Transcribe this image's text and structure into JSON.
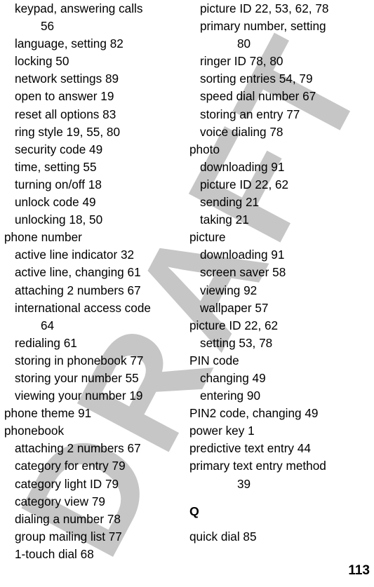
{
  "page": {
    "folio": "113",
    "watermark": "DRAFT",
    "watermark_color": "#c3c3c3",
    "text_color": "#000000",
    "background_color": "#ffffff"
  },
  "columns": [
    {
      "name": "left-column",
      "entries": [
        {
          "level": 1,
          "text": "keypad, answering calls"
        },
        {
          "level": "cont",
          "text": "56"
        },
        {
          "level": 1,
          "text": "language, setting  82"
        },
        {
          "level": 1,
          "text": "locking  50"
        },
        {
          "level": 1,
          "text": "network settings  89"
        },
        {
          "level": 1,
          "text": "open to answer  19"
        },
        {
          "level": 1,
          "text": "reset all options  83"
        },
        {
          "level": 1,
          "text": "ring style  19, 55, 80"
        },
        {
          "level": 1,
          "text": "security code  49"
        },
        {
          "level": 1,
          "text": "time, setting  55"
        },
        {
          "level": 1,
          "text": "turning on/off  18"
        },
        {
          "level": 1,
          "text": "unlock code  49"
        },
        {
          "level": 1,
          "text": "unlocking  18, 50"
        },
        {
          "level": 0,
          "text": "phone number"
        },
        {
          "level": 1,
          "text": "active line indicator  32"
        },
        {
          "level": 1,
          "text": "active line, changing  61"
        },
        {
          "level": 1,
          "text": "attaching 2 numbers  67"
        },
        {
          "level": 1,
          "text": "international access code"
        },
        {
          "level": "cont",
          "text": "64"
        },
        {
          "level": 1,
          "text": "redialing  61"
        },
        {
          "level": 1,
          "text": "storing in phonebook  77"
        },
        {
          "level": 1,
          "text": "storing your number  55"
        },
        {
          "level": 1,
          "text": "viewing your number  19"
        },
        {
          "level": 0,
          "text": "phone theme  91"
        },
        {
          "level": 0,
          "text": "phonebook"
        },
        {
          "level": 1,
          "text": "attaching 2 numbers  67"
        },
        {
          "level": 1,
          "text": "category for entry  79"
        },
        {
          "level": 1,
          "text": "category light ID  79"
        },
        {
          "level": 1,
          "text": "category view  79"
        },
        {
          "level": 1,
          "text": "dialing a number  78"
        },
        {
          "level": 1,
          "text": "group mailing list  77"
        },
        {
          "level": 1,
          "text": "1-touch dial  68"
        }
      ]
    },
    {
      "name": "right-column",
      "entries": [
        {
          "level": 1,
          "text": "picture ID  22, 53, 62, 78"
        },
        {
          "level": 1,
          "text": "primary number, setting"
        },
        {
          "level": "cont-r",
          "text": "80"
        },
        {
          "level": 1,
          "text": "ringer ID  78, 80"
        },
        {
          "level": 1,
          "text": "sorting entries  54, 79"
        },
        {
          "level": 1,
          "text": "speed dial number  67"
        },
        {
          "level": 1,
          "text": "storing an entry  77"
        },
        {
          "level": 1,
          "text": "voice dialing  78"
        },
        {
          "level": 0,
          "text": "photo"
        },
        {
          "level": 1,
          "text": "downloading  91"
        },
        {
          "level": 1,
          "text": "picture ID  22, 62"
        },
        {
          "level": 1,
          "text": "sending  21"
        },
        {
          "level": 1,
          "text": "taking  21"
        },
        {
          "level": 0,
          "text": "picture"
        },
        {
          "level": 1,
          "text": "downloading  91"
        },
        {
          "level": 1,
          "text": "screen saver  58"
        },
        {
          "level": 1,
          "text": "viewing  92"
        },
        {
          "level": 1,
          "text": "wallpaper  57"
        },
        {
          "level": 0,
          "text": "picture ID  22, 62"
        },
        {
          "level": 1,
          "text": "setting  53, 78"
        },
        {
          "level": 0,
          "text": "PIN code"
        },
        {
          "level": 1,
          "text": "changing  49"
        },
        {
          "level": 1,
          "text": "entering  90"
        },
        {
          "level": 0,
          "text": "PIN2 code, changing  49"
        },
        {
          "level": 0,
          "text": "power key  1"
        },
        {
          "level": 0,
          "text": "predictive text entry  44"
        },
        {
          "level": 0,
          "text": "primary text entry method"
        },
        {
          "level": "cont-r",
          "text": "39"
        },
        {
          "level": "head",
          "text": "Q"
        },
        {
          "level": 0,
          "text": "quick dial  85"
        }
      ]
    }
  ]
}
